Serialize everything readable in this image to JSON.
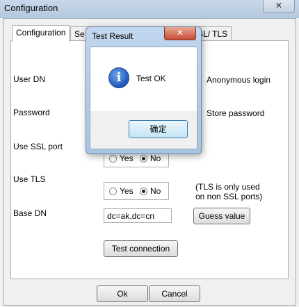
{
  "window": {
    "title": "Configuration",
    "close_glyph": "✕",
    "close_icon": "close-icon"
  },
  "tabs": [
    {
      "label": "Configuration"
    },
    {
      "label": "Se"
    },
    {
      "label": "SL/ TLS"
    }
  ],
  "form": {
    "user_dn_label": "User DN",
    "anonymous_login_label": "Anonymous login",
    "password_label": "Password",
    "store_password_label": "Store password",
    "use_ssl_port_label": "Use SSL port",
    "use_tls_label": "Use TLS",
    "base_dn_label": "Base DN",
    "yes_label": "Yes",
    "no_label": "No",
    "ssl_selected": "No",
    "tls_selected": "No",
    "tls_note_line1": "(TLS is only used",
    "tls_note_line2": "on non SSL ports)",
    "base_dn_value": "dc=ak,dc=cn",
    "guess_value_button": "Guess value",
    "test_connection_button": "Test connection"
  },
  "footer": {
    "ok_button": "Ok",
    "cancel_button": "Cancel"
  },
  "dialog": {
    "title": "Test Result",
    "close_glyph": "✕",
    "message": "Test OK",
    "icon": "info-icon",
    "icon_glyph": "i",
    "confirm_button": "确定"
  }
}
